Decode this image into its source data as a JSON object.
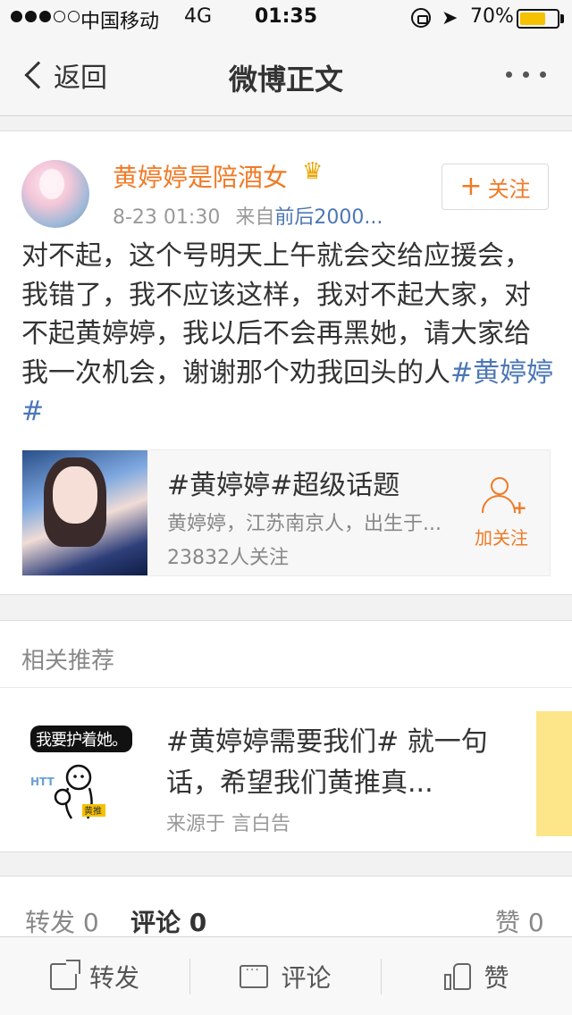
{
  "status_bar": {
    "carrier": "中国移动",
    "network": "4G",
    "time": "01:35",
    "battery_percent": "70%",
    "battery_level": 0.7
  },
  "nav": {
    "back_label": "返回",
    "title": "微博正文"
  },
  "post": {
    "username": "黄婷婷是陪酒女",
    "timestamp": "8-23 01:30",
    "source_prefix": "来自",
    "source": "前后2000...",
    "follow_label": "关注",
    "text": "对不起，这个号明天上午就会交给应援会，我错了，我不应该这样，我对不起大家，对不起黄婷婷，我以后不会再黑她，请大家给我一次机会，谢谢那个劝我回头的人",
    "hashtag": "#黄婷婷#",
    "topic": {
      "title": "#黄婷婷#超级话题",
      "description": "黄婷婷，江苏南京人，出生于...",
      "followers": "23832人关注",
      "follow_label": "加关注"
    }
  },
  "related": {
    "header": "相关推荐",
    "item": {
      "image_caption": "我要护着她。",
      "image_tag_htt": "HTT",
      "image_tag_huang": "黄推",
      "text": "#黄婷婷需要我们# 就一句话，希望我们黄推真...",
      "source": "来源于 言白告"
    }
  },
  "stats": {
    "repost": "转发 0",
    "comment": "评论 0",
    "like": "赞 0"
  },
  "toolbar": {
    "repost_label": "转发",
    "comment_label": "评论",
    "like_label": "赞"
  },
  "colors": {
    "accent_orange": "#f07a26",
    "link_blue": "#4c77b5",
    "battery_yellow": "#f6c100"
  }
}
